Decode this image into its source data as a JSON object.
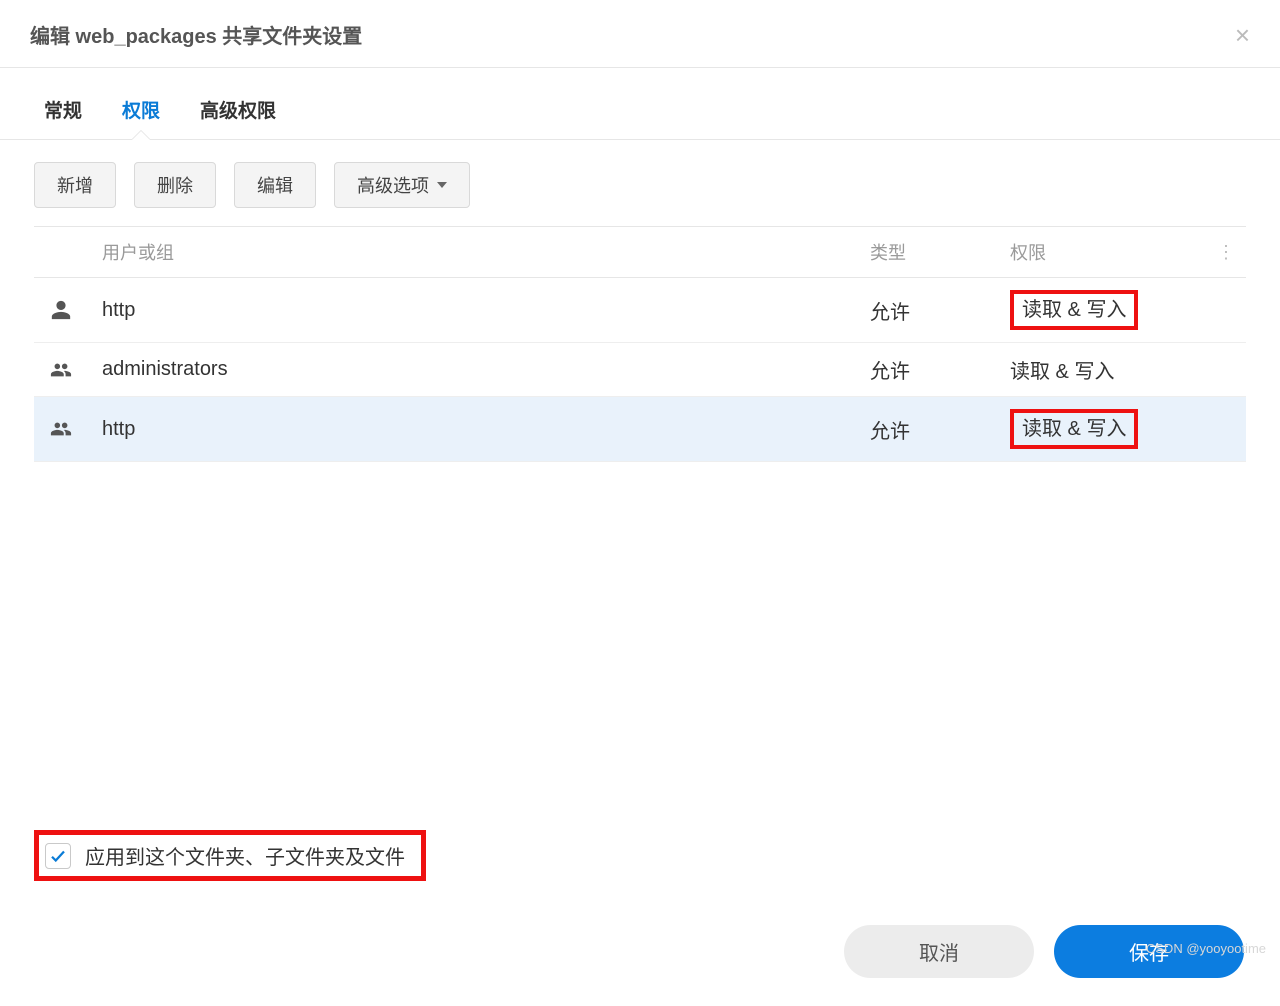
{
  "dialog": {
    "title": "编辑 web_packages 共享文件夹设置",
    "close_icon": "×"
  },
  "tabs": {
    "general": "常规",
    "permission": "权限",
    "advanced": "高级权限",
    "active_index": 1
  },
  "toolbar": {
    "add": "新增",
    "delete": "删除",
    "edit": "编辑",
    "advanced_options": "高级选项"
  },
  "table": {
    "headers": {
      "user_or_group": "用户或组",
      "type": "类型",
      "permission": "权限"
    },
    "rows": [
      {
        "icon": "user",
        "name": "http",
        "type": "允许",
        "permission": "读取 & 写入",
        "highlight": true,
        "selected": false
      },
      {
        "icon": "group",
        "name": "administrators",
        "type": "允许",
        "permission": "读取 & 写入",
        "highlight": false,
        "selected": false
      },
      {
        "icon": "group",
        "name": "http",
        "type": "允许",
        "permission": "读取 & 写入",
        "highlight": true,
        "selected": true
      }
    ]
  },
  "checkbox": {
    "label": "应用到这个文件夹、子文件夹及文件",
    "checked": true
  },
  "footer": {
    "cancel": "取消",
    "save": "保存"
  },
  "watermark": "CSDN @yooyootime"
}
